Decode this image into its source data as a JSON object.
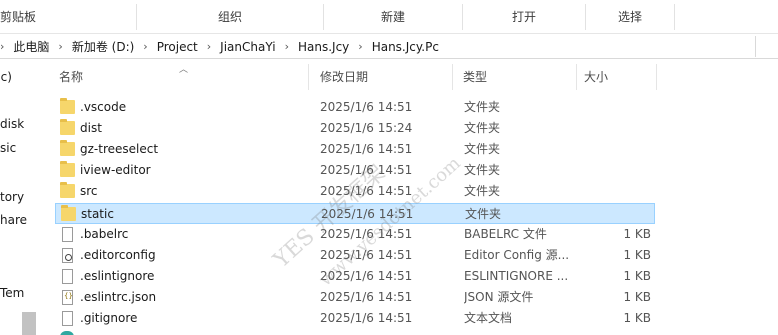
{
  "ribbon": {
    "groups": [
      "剪贴板",
      "组织",
      "新建",
      "打开",
      "选择"
    ]
  },
  "address": {
    "crumbs": [
      "此电脑",
      "新加卷 (D:)",
      "Project",
      "JianChaYi",
      "Hans.Jcy",
      "Hans.Jcy.Pc"
    ]
  },
  "nav": {
    "items": [
      "(c)",
      "disk",
      "sic",
      "tory",
      "hare",
      "Tem"
    ]
  },
  "columns": {
    "name": "名称",
    "modified": "修改日期",
    "type": "类型",
    "size": "大小"
  },
  "files": [
    {
      "name": ".vscode",
      "modified": "2025/1/6 14:51",
      "type": "文件夹",
      "size": "",
      "icon": "folder-icon"
    },
    {
      "name": "dist",
      "modified": "2025/1/6 15:24",
      "type": "文件夹",
      "size": "",
      "icon": "folder-icon"
    },
    {
      "name": "gz-treeselect",
      "modified": "2025/1/6 14:51",
      "type": "文件夹",
      "size": "",
      "icon": "folder-icon"
    },
    {
      "name": "iview-editor",
      "modified": "2025/1/6 14:51",
      "type": "文件夹",
      "size": "",
      "icon": "folder-icon"
    },
    {
      "name": "src",
      "modified": "2025/1/6 14:51",
      "type": "文件夹",
      "size": "",
      "icon": "folder-icon"
    },
    {
      "name": "static",
      "modified": "2025/1/6 14:51",
      "type": "文件夹",
      "size": "",
      "icon": "folder-icon",
      "selected": true
    },
    {
      "name": ".babelrc",
      "modified": "2025/1/6 14:51",
      "type": "BABELRC 文件",
      "size": "1 KB",
      "icon": "file-icon"
    },
    {
      "name": ".editorconfig",
      "modified": "2025/1/6 14:51",
      "type": "Editor Config 源...",
      "size": "1 KB",
      "icon": "config-file-icon"
    },
    {
      "name": ".eslintignore",
      "modified": "2025/1/6 14:51",
      "type": "ESLINTIGNORE ...",
      "size": "1 KB",
      "icon": "file-icon"
    },
    {
      "name": ".eslintrc.json",
      "modified": "2025/1/6 14:51",
      "type": "JSON 源文件",
      "size": "1 KB",
      "icon": "json-file-icon"
    },
    {
      "name": ".gitignore",
      "modified": "2025/1/6 14:51",
      "type": "文本文档",
      "size": "1 KB",
      "icon": "file-icon"
    }
  ],
  "watermark": {
    "line1": "YES 开发框架",
    "line2": "www.yesdotnet.com"
  },
  "colors": {
    "selection_bg": "#cce8ff",
    "selection_border": "#99d1ff",
    "folder": "#f6d66b"
  }
}
